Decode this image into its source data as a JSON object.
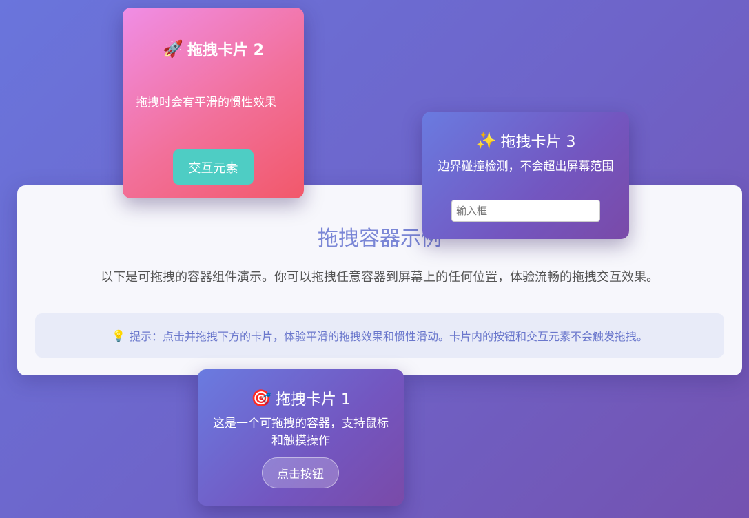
{
  "container": {
    "title": "拖拽容器示例",
    "description": "以下是可拖拽的容器组件演示。你可以拖拽任意容器到屏幕上的任何位置，体验流畅的拖拽交互效果。",
    "tip_icon": "💡",
    "tip": "提示：点击并拖拽下方的卡片，体验平滑的拖拽效果和惯性滑动。卡片内的按钮和交互元素不会触发拖拽。"
  },
  "cards": {
    "card2": {
      "icon": "🚀",
      "icon_name": "rocket-icon",
      "title": "拖拽卡片 2",
      "text": "拖拽时会有平滑的惯性效果",
      "button_label": "交互元素"
    },
    "card3": {
      "icon": "✨",
      "icon_name": "sparkles-icon",
      "title": "拖拽卡片 3",
      "text": "边界碰撞检测，不会超出屏幕范围",
      "input_placeholder": "输入框",
      "input_value": ""
    },
    "card1": {
      "icon": "🎯",
      "icon_name": "target-icon",
      "title": "拖拽卡片 1",
      "text": "这是一个可拖拽的容器，支持鼠标和触摸操作",
      "button_label": "点击按钮"
    }
  },
  "colors": {
    "background_start": "#6a75dc",
    "background_end": "#7452b0",
    "title_accent": "#7a86d6",
    "tip_text": "#6a77cc",
    "card2_gradient": [
      "#f08ee6",
      "#f2586a"
    ],
    "teal_button": "#4ecdc4",
    "purple_card_gradient": [
      "#6a7be0",
      "#7a4aa8"
    ]
  }
}
